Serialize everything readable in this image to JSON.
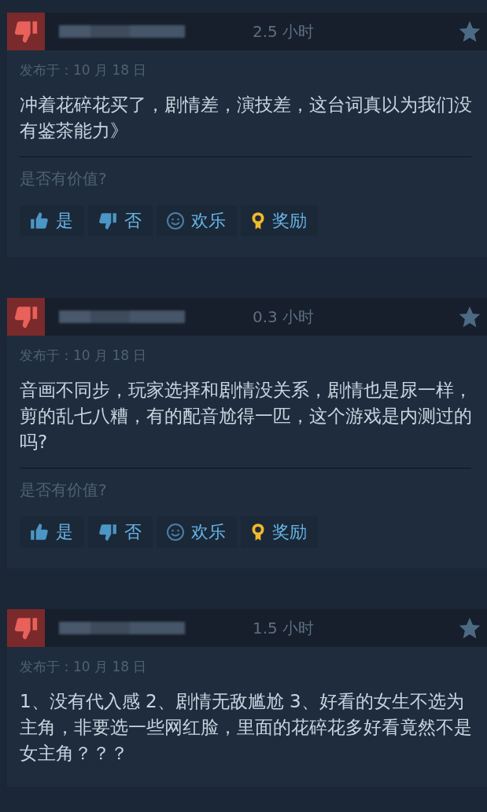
{
  "reviews": [
    {
      "recommended": false,
      "hours": "2.5 小时",
      "date": "发布于：10 月 18 日",
      "text": "冲着花碎花买了，剧情差，演技差，这台词真以为我们没有鉴茶能力》",
      "helpful_prompt": "是否有价值?",
      "buttons": [
        {
          "kind": "yes",
          "label": "是"
        },
        {
          "kind": "no",
          "label": "否"
        },
        {
          "kind": "funny",
          "label": "欢乐"
        },
        {
          "kind": "award",
          "label": "奖励"
        }
      ]
    },
    {
      "recommended": false,
      "hours": "0.3 小时",
      "date": "发布于：10 月 18 日",
      "text": "音画不同步，玩家选择和剧情没关系，剧情也是尿一样，剪的乱七八糟，有的配音尬得一匹，这个游戏是内测过的吗?",
      "helpful_prompt": "是否有价值?",
      "buttons": [
        {
          "kind": "yes",
          "label": "是"
        },
        {
          "kind": "no",
          "label": "否"
        },
        {
          "kind": "funny",
          "label": "欢乐"
        },
        {
          "kind": "award",
          "label": "奖励"
        }
      ]
    },
    {
      "recommended": false,
      "hours": "1.5 小时",
      "date": "发布于：10 月 18 日",
      "text": "1、没有代入感 2、剧情无敌尴尬 3、好看的女生不选为主角，非要选一些网红脸，里面的花碎花多好看竟然不是女主角？？？"
    }
  ]
}
